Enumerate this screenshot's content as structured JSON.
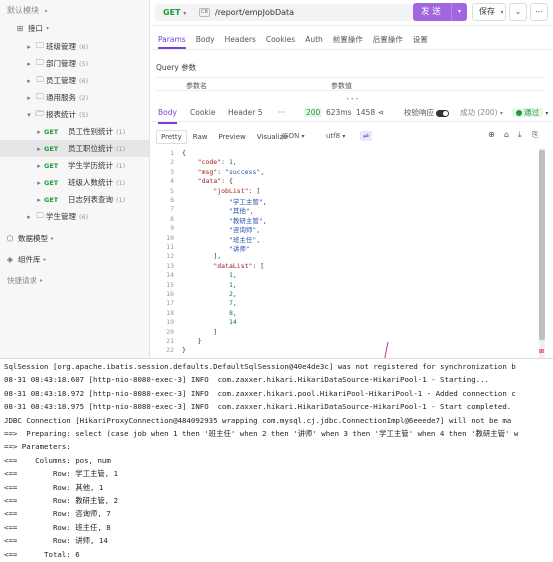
{
  "sidebar": {
    "header": "默认模块",
    "header_caret": "▾",
    "root": {
      "label": "接口",
      "caret": "▾"
    },
    "folders_before": [
      {
        "label": "班级管理",
        "count": "(6)"
      },
      {
        "label": "部门管理",
        "count": "(5)"
      },
      {
        "label": "员工管理",
        "count": "(6)"
      },
      {
        "label": "通用服务",
        "count": "(2)"
      }
    ],
    "open_folder": {
      "label": "报表统计",
      "count": "(5)"
    },
    "requests": [
      {
        "method": "GET",
        "label": "员工性别统计",
        "count": "(1)"
      },
      {
        "method": "GET",
        "label": "员工职位统计",
        "count": "(1)",
        "active": true
      },
      {
        "method": "GET",
        "label": "学生学历统计",
        "count": "(1)"
      },
      {
        "method": "GET",
        "label": "班级人数统计",
        "count": "(1)"
      },
      {
        "method": "GET",
        "label": "日志列表查询",
        "count": "(1)"
      }
    ],
    "folder_after": {
      "label": "学生管理",
      "count": "(6)"
    },
    "data_model": "数据模型",
    "components": "组件库",
    "quick_request": "快捷请求",
    "caret_right": "▸",
    "caret_down": "▾"
  },
  "urlbar": {
    "method": "GET",
    "method_caret": "▾",
    "env_badge": "CB",
    "url": "/report/empJobData",
    "send_label": "发 送",
    "send_caret": "▾",
    "save_label": "保存",
    "save_caret": "▾",
    "more_icon": "⌄",
    "menu_icon": "⋯"
  },
  "request_tabs": [
    "Params",
    "Body",
    "Headers",
    "Cookies",
    "Auth",
    "前置操作",
    "后置操作",
    "设置"
  ],
  "query_params": {
    "title": "Query 参数",
    "col_name": "参数名",
    "col_value": "参数值",
    "drag_handle": "•••"
  },
  "response": {
    "tabs": [
      "Body",
      "Cookie",
      "Header 5",
      "···"
    ],
    "status_code": "200",
    "time": "623ms",
    "size": "1458",
    "validate_label": "校验响应",
    "success_label": "成功 (200)",
    "success_caret": "▾",
    "pass_label": "通过",
    "pass_caret": "▾",
    "view_tabs": [
      "Pretty",
      "Raw",
      "Preview",
      "Visualize"
    ],
    "format": "JSON",
    "format_caret": "▾",
    "encoding": "utf8",
    "encoding_caret": "▾",
    "wrap_icon": "⇌",
    "right_icons": [
      "⊕",
      "⌂",
      "⤓",
      "⎘"
    ]
  },
  "json_lines": [
    [
      "1",
      [
        [
          "p",
          "{"
        ]
      ]
    ],
    [
      "2",
      [
        [
          "p",
          "    "
        ],
        [
          "k",
          "\"code\""
        ],
        [
          "p",
          ": "
        ],
        [
          "n",
          "1"
        ],
        [
          "p",
          ","
        ]
      ]
    ],
    [
      "3",
      [
        [
          "p",
          "    "
        ],
        [
          "k",
          "\"msg\""
        ],
        [
          "p",
          ": "
        ],
        [
          "s",
          "\"success\""
        ],
        [
          "p",
          ","
        ]
      ]
    ],
    [
      "4",
      [
        [
          "p",
          "    "
        ],
        [
          "k",
          "\"data\""
        ],
        [
          "p",
          ": {"
        ]
      ]
    ],
    [
      "5",
      [
        [
          "p",
          "        "
        ],
        [
          "k",
          "\"jobList\""
        ],
        [
          "p",
          ": ["
        ]
      ]
    ],
    [
      "6",
      [
        [
          "p",
          "            "
        ],
        [
          "s",
          "\"学工主管\""
        ],
        [
          "p",
          ","
        ]
      ]
    ],
    [
      "7",
      [
        [
          "p",
          "            "
        ],
        [
          "s",
          "\"其他\""
        ],
        [
          "p",
          ","
        ]
      ]
    ],
    [
      "8",
      [
        [
          "p",
          "            "
        ],
        [
          "s",
          "\"教研主管\""
        ],
        [
          "p",
          ","
        ]
      ]
    ],
    [
      "9",
      [
        [
          "p",
          "            "
        ],
        [
          "s",
          "\"咨询师\""
        ],
        [
          "p",
          ","
        ]
      ]
    ],
    [
      "10",
      [
        [
          "p",
          "            "
        ],
        [
          "s",
          "\"班主任\""
        ],
        [
          "p",
          ","
        ]
      ]
    ],
    [
      "11",
      [
        [
          "p",
          "            "
        ],
        [
          "s",
          "\"讲师\""
        ]
      ]
    ],
    [
      "12",
      [
        [
          "p",
          "        ],"
        ]
      ]
    ],
    [
      "13",
      [
        [
          "p",
          "        "
        ],
        [
          "k",
          "\"dataList\""
        ],
        [
          "p",
          ": ["
        ]
      ]
    ],
    [
      "14",
      [
        [
          "p",
          "            "
        ],
        [
          "n",
          "1"
        ],
        [
          "p",
          ","
        ]
      ]
    ],
    [
      "15",
      [
        [
          "p",
          "            "
        ],
        [
          "n",
          "1"
        ],
        [
          "p",
          ","
        ]
      ]
    ],
    [
      "16",
      [
        [
          "p",
          "            "
        ],
        [
          "n",
          "2"
        ],
        [
          "p",
          ","
        ]
      ]
    ],
    [
      "17",
      [
        [
          "p",
          "            "
        ],
        [
          "n",
          "7"
        ],
        [
          "p",
          ","
        ]
      ]
    ],
    [
      "18",
      [
        [
          "p",
          "            "
        ],
        [
          "n",
          "8"
        ],
        [
          "p",
          ","
        ]
      ]
    ],
    [
      "19",
      [
        [
          "p",
          "            "
        ],
        [
          "n",
          "14"
        ]
      ]
    ],
    [
      "20",
      [
        [
          "p",
          "        ]"
        ]
      ]
    ],
    [
      "21",
      [
        [
          "p",
          "    }"
        ]
      ]
    ],
    [
      "22",
      [
        [
          "p",
          "}"
        ]
      ]
    ]
  ],
  "console": [
    "SqlSession [org.apache.ibatis.session.defaults.DefaultSqlSession@40e4de3c] was not registered for synchronization b",
    "08-31 08:43:18.607 [http-nio-8080-exec-3] INFO  com.zaxxer.hikari.HikariDataSource-HikariPool-1 - Starting...",
    "08-31 08:43:18.972 [http-nio-8080-exec-3] INFO  com.zaxxer.hikari.pool.HikariPool-HikariPool-1 - Added connection c",
    "08-31 08:43:18.975 [http-nio-8080-exec-3] INFO  com.zaxxer.hikari.HikariDataSource-HikariPool-1 - Start completed.",
    "JDBC Connection [HikariProxyConnection@484092935 wrapping com.mysql.cj.jdbc.ConnectionImpl@6eeede7] will not be ma",
    "==>  Preparing: select (case job when 1 then '班主任' when 2 then '讲师' when 3 then '学工主管' when 4 then '教研主管' w",
    "==> Parameters: ",
    "<==    Columns: pos, num",
    "<==        Row: 学工主管, 1",
    "<==        Row: 其他, 1",
    "<==        Row: 教研主管, 2",
    "<==        Row: 咨询师, 7",
    "<==        Row: 班主任, 8",
    "<==        Row: 讲师, 14",
    "<==      Total: 6"
  ]
}
